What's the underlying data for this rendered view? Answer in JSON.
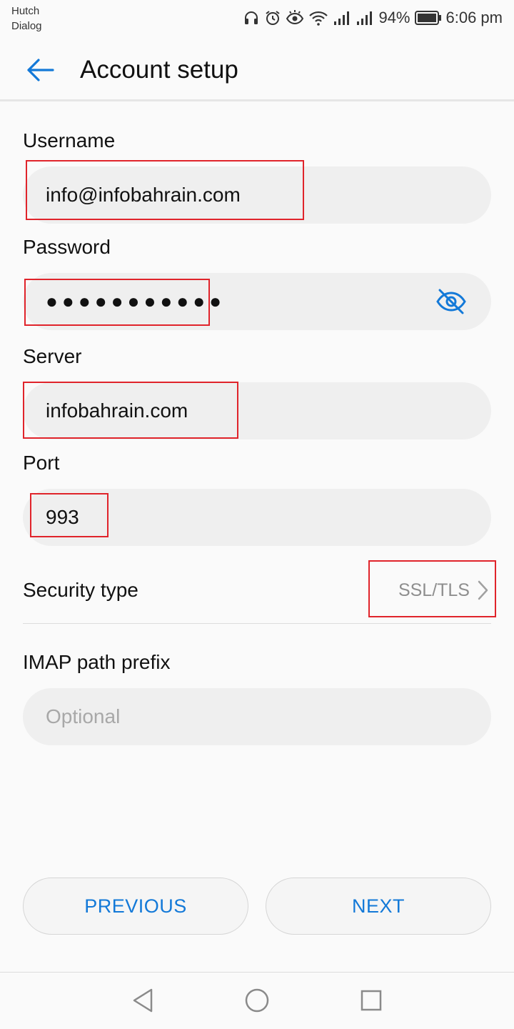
{
  "status_bar": {
    "carrier_line1": "Hutch",
    "carrier_line2": "Dialog",
    "battery": "94%",
    "time": "6:06 pm"
  },
  "header": {
    "title": "Account setup"
  },
  "form": {
    "username": {
      "label": "Username",
      "value": "info@infobahrain.com"
    },
    "password": {
      "label": "Password",
      "value": "●●●●●●●●●●●"
    },
    "server": {
      "label": "Server",
      "value": "infobahrain.com"
    },
    "port": {
      "label": "Port",
      "value": "993"
    },
    "security_type": {
      "label": "Security type",
      "value": "SSL/TLS"
    },
    "imap_path_prefix": {
      "label": "IMAP path prefix",
      "value": "",
      "placeholder": "Optional"
    }
  },
  "buttons": {
    "previous": "PREVIOUS",
    "next": "NEXT"
  },
  "colors": {
    "accent": "#1379d8",
    "highlight_box": "#e0242b",
    "field_background": "#efefef",
    "page_background": "#fafafa"
  },
  "icons": [
    "headset-icon",
    "alarm-icon",
    "eye-comfort-icon",
    "wifi-icon",
    "signal-icon",
    "battery-icon",
    "back-arrow-icon",
    "visibility-off-icon",
    "chevron-right-icon",
    "nav-back-icon",
    "nav-home-icon",
    "nav-recents-icon"
  ]
}
